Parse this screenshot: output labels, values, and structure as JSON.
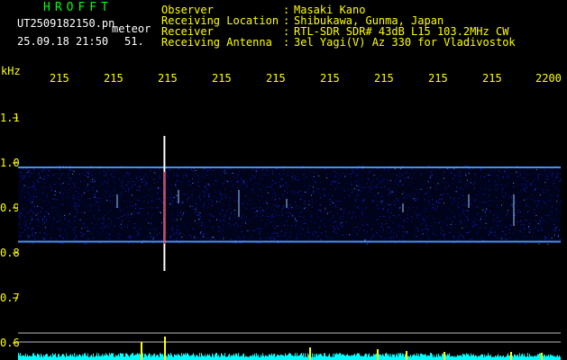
{
  "header": {
    "program_title": "HROFFT",
    "filename": "UT2509182150.pn",
    "tag": "meteor",
    "datetime": "25.09.18 21:50",
    "extra": "51."
  },
  "info": {
    "labels": [
      "Observer",
      "Receiving Location",
      "Receiver",
      "Receiving Antenna"
    ],
    "separator": ":",
    "values": [
      "Masaki Kano",
      "Shibukawa, Gunma, Japan",
      "RTL-SDR SDR# 43dB L15 103.2MHz CW",
      "3el Yagi(V) Az 330 for Vladivostok"
    ]
  },
  "chart_data": {
    "type": "heatmap",
    "ylabel": "kHz",
    "x_tick_labels": [
      "215",
      "215",
      "215",
      "215",
      "215",
      "215",
      "215",
      "215",
      "215",
      "2200"
    ],
    "y_tick_labels": [
      "1.1",
      "1.0",
      "0.9",
      "0.8",
      "0.7",
      "0.6"
    ],
    "y_ticks": [
      1.1,
      1.0,
      0.9,
      0.8,
      0.7,
      0.6
    ],
    "ylim": [
      0.58,
      1.16
    ],
    "noise_band": [
      0.82,
      0.995
    ],
    "band_edges": [
      0.99,
      0.825
    ],
    "meteor_echo": {
      "x_fraction": 0.29,
      "freq_range": [
        0.76,
        1.06
      ]
    },
    "colors": {
      "background": "#000000",
      "axis_text": "#ffff00",
      "noise": "#1a2aff",
      "band_edge": "#55aaff",
      "echo_core": "#ff3355",
      "echo_halo": "#ffffff",
      "meter_base": "#00ffff",
      "meter_peak": "#ffff00",
      "guide_line": "#bbbbbb"
    }
  }
}
